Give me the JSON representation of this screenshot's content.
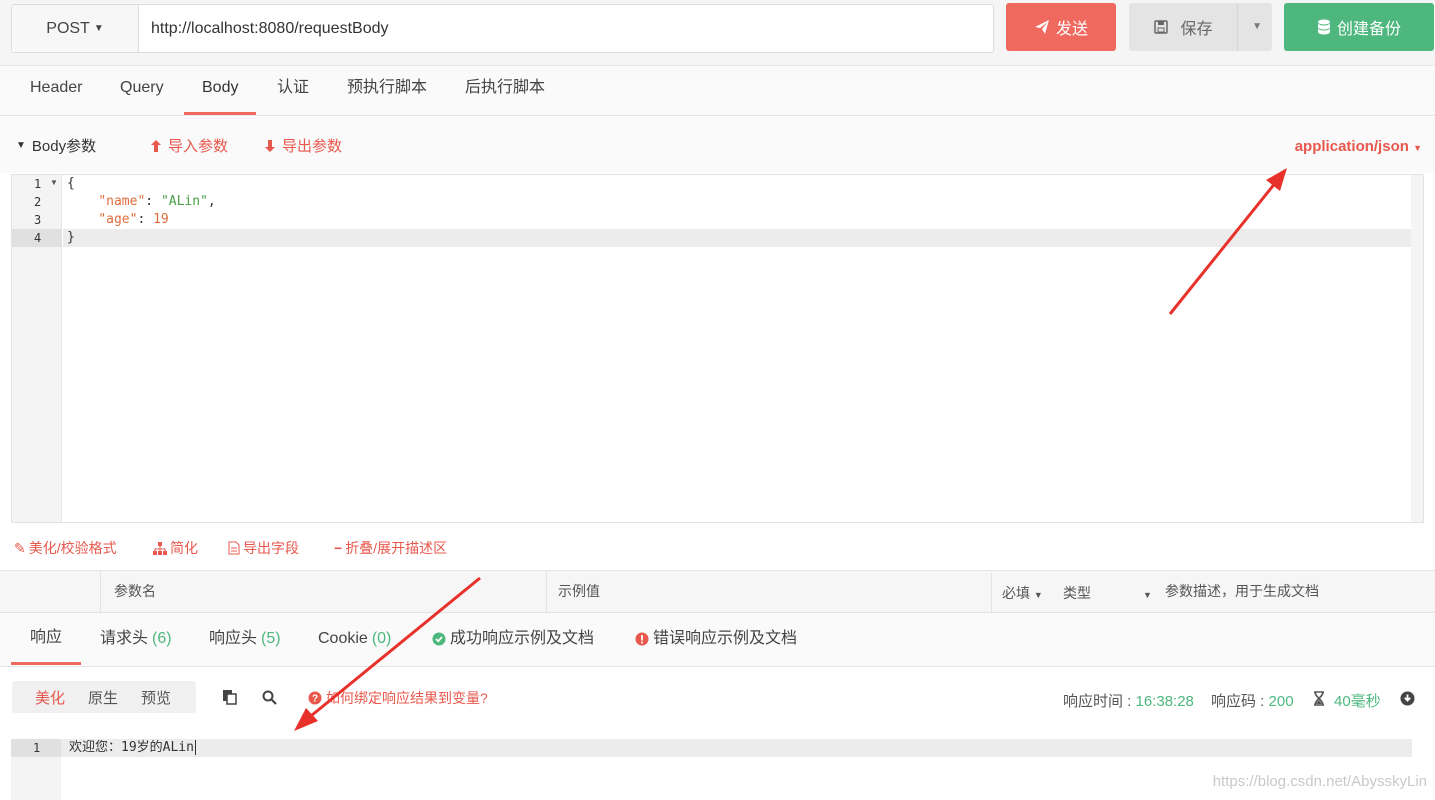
{
  "request": {
    "method": "POST",
    "url": "http://localhost:8080/requestBody",
    "send_label": "发送",
    "save_label": "保存",
    "backup_label": "创建备份"
  },
  "tabs": [
    {
      "label": "Header"
    },
    {
      "label": "Query"
    },
    {
      "label": "Body",
      "active": true
    },
    {
      "label": "认证"
    },
    {
      "label": "预执行脚本"
    },
    {
      "label": "后执行脚本"
    }
  ],
  "body_section": {
    "title": "Body参数",
    "import_label": "导入参数",
    "export_label": "导出参数",
    "content_type": "application/json"
  },
  "editor": {
    "line_numbers": [
      "1",
      "2",
      "3",
      "4"
    ],
    "lines": {
      "l1": "{",
      "l2_key": "\"name\"",
      "l2_sep": ": ",
      "l2_val": "\"ALin\"",
      "l2_end": ",",
      "l3_key": "\"age\"",
      "l3_sep": ": ",
      "l3_val": "19",
      "l4": "}"
    }
  },
  "editor_tools": {
    "beautify": "美化/校验格式",
    "simplify": "简化",
    "export_fields": "导出字段",
    "fold": "折叠/展开描述区"
  },
  "param_table": {
    "col_name": "参数名",
    "col_example": "示例值",
    "col_required": "必填",
    "col_type": "类型",
    "col_desc": "参数描述，用于生成文档"
  },
  "response_tabs": {
    "response": "响应",
    "req_headers": "请求头",
    "req_headers_count": "(6)",
    "resp_headers": "响应头",
    "resp_headers_count": "(5)",
    "cookie": "Cookie",
    "cookie_count": "(0)",
    "success_docs": "成功响应示例及文档",
    "error_docs": "错误响应示例及文档"
  },
  "response_bar": {
    "beautify": "美化",
    "raw": "原生",
    "preview": "预览",
    "help_link": "如何绑定响应结果到变量?",
    "time_label": "响应时间 :",
    "time_value": "16:38:28",
    "code_label": "响应码 :",
    "code_value": "200",
    "duration": "40毫秒"
  },
  "response_body": {
    "line_number": "1",
    "text": "欢迎您：19岁的ALin"
  },
  "watermark": "https://blog.csdn.net/AbysskyLin",
  "colors": {
    "accent_red": "#f0695e",
    "green": "#4db77e"
  }
}
